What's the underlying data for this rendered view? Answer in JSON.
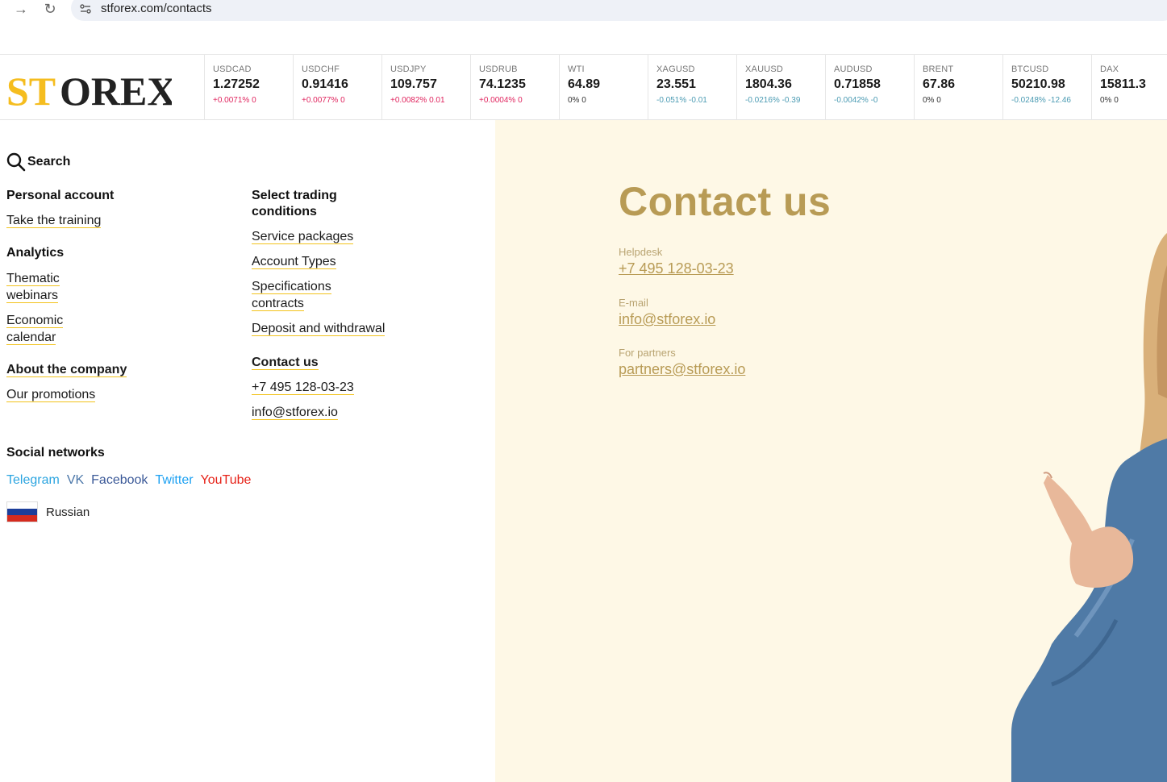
{
  "browser": {
    "url": "stforex.com/contacts"
  },
  "logo": {
    "part1": "ST",
    "part2": "OREX",
    "colors": {
      "yellow": "#f5bd1f",
      "dark": "#222222"
    }
  },
  "ticker": [
    {
      "symbol": "USDCAD",
      "price": "1.27252",
      "change": "+0.0071% 0",
      "trend": "up"
    },
    {
      "symbol": "USDCHF",
      "price": "0.91416",
      "change": "+0.0077% 0",
      "trend": "up"
    },
    {
      "symbol": "USDJPY",
      "price": "109.757",
      "change": "+0.0082% 0.01",
      "trend": "up"
    },
    {
      "symbol": "USDRUB",
      "price": "74.1235",
      "change": "+0.0004% 0",
      "trend": "up"
    },
    {
      "symbol": "WTI",
      "price": "64.89",
      "change": "0% 0",
      "trend": "flat"
    },
    {
      "symbol": "XAGUSD",
      "price": "23.551",
      "change": "-0.051% -0.01",
      "trend": "down"
    },
    {
      "symbol": "XAUUSD",
      "price": "1804.36",
      "change": "-0.0216% -0.39",
      "trend": "down"
    },
    {
      "symbol": "AUDUSD",
      "price": "0.71858",
      "change": "-0.0042% -0",
      "trend": "down"
    },
    {
      "symbol": "BRENT",
      "price": "67.86",
      "change": "0% 0",
      "trend": "flat"
    },
    {
      "symbol": "BTCUSD",
      "price": "50210.98",
      "change": "-0.0248% -12.46",
      "trend": "down"
    },
    {
      "symbol": "DAX",
      "price": "15811.3",
      "change": "0% 0",
      "trend": "flat"
    }
  ],
  "menu": {
    "search_label": "Search",
    "personal_account": "Personal account",
    "take_training": "Take the training",
    "analytics": "Analytics",
    "thematic_webinars_1": "Thematic",
    "thematic_webinars_2": "webinars",
    "economic_calendar_1": "Economic",
    "economic_calendar_2": "calendar",
    "about_company": "About the company",
    "our_promotions": "Our promotions",
    "select_trading_1": "Select trading",
    "select_trading_2": "conditions",
    "service_packages": "Service packages",
    "account_types": "Account Types",
    "specifications_1": "Specifications",
    "specifications_2": "contracts",
    "deposit_withdrawal": "Deposit and withdrawal",
    "contact_us": "Contact us",
    "phone": "+7 495 128-03-23",
    "email": "info@stforex.io",
    "social_title": "Social networks",
    "social": [
      {
        "label": "Telegram",
        "color": "#2ca5e0"
      },
      {
        "label": "VK",
        "color": "#4a76a8"
      },
      {
        "label": "Facebook",
        "color": "#3b5998"
      },
      {
        "label": "Twitter",
        "color": "#1da1f2"
      },
      {
        "label": "YouTube",
        "color": "#e62117"
      }
    ],
    "language": "Russian"
  },
  "contact": {
    "title": "Contact us",
    "helpdesk_label": "Helpdesk",
    "helpdesk_value": "+7 495 128-03-23",
    "email_label": "E-mail",
    "email_value": "info@stforex.io",
    "partners_label": "For partners",
    "partners_value": "partners@stforex.io",
    "accent_color": "#b89b55",
    "panel_color": "#fef8e6"
  }
}
